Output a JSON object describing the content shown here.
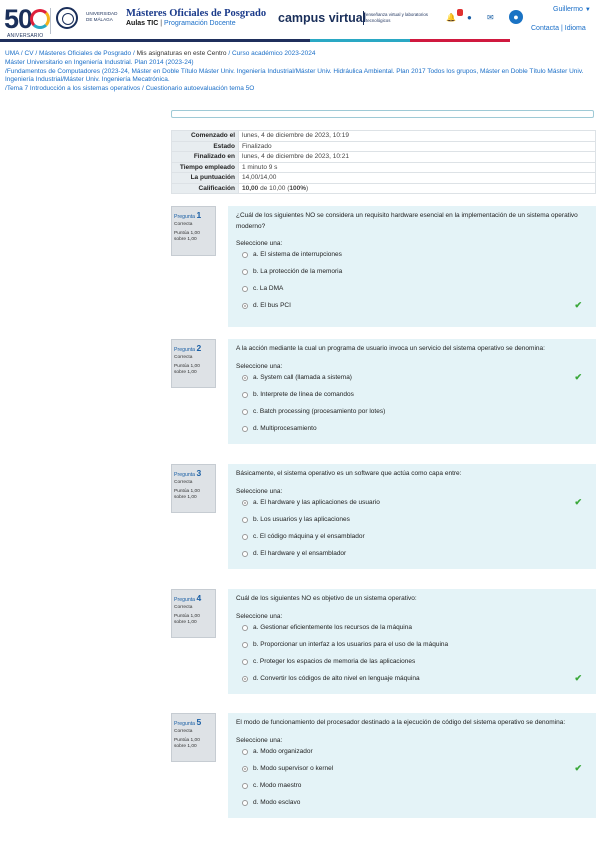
{
  "header": {
    "logo_number": "50",
    "logo_caption": "ANIVERSARIO",
    "university_name": "UNIVERSIDAD DE MÁLAGA",
    "masters_title": "Másteres Oficiales de Posgrado",
    "aulas_label": "Aulas TIC",
    "divider": "|",
    "programacion_label": "Programación Docente",
    "campus_title": "campus virtual",
    "campus_tagline": "enseñanza virtual y laboratorios tecnológicos",
    "notifications_badge": "",
    "user_name": "Guillermo",
    "contact_label": "Contacta",
    "links_sep": "|",
    "language_label": "Idioma",
    "accent_bar_colors": [
      "#1f2f5c",
      "#2aa8c4",
      "#d0193f"
    ]
  },
  "breadcrumb": [
    {
      "label": "UMA",
      "sep": "/ "
    },
    {
      "label": "CV",
      "sep": "/ "
    },
    {
      "label": "Másteres Oficiales de Posgrado",
      "sep": "/ "
    },
    {
      "label": "Mis asignaturas en este Centro",
      "sep": "/ ",
      "current": true
    },
    {
      "label": "Curso académico 2023-2024",
      "sep": ""
    },
    {
      "label": "Máster Universitario en Ingeniería Industrial. Plan 2014 (2023-24)",
      "sep": "/"
    },
    {
      "label": "Fundamentos de Computadores (2023-24, Máster en Doble Título Máster Univ. Ingeniería Industrial/Máster Univ. Hidráulica Ambiental. Plan 2017 Todos los grupos, Máster en Doble Título Máster Univ. Ingeniería Industrial/Máster Univ. Ingeniería Mecatrónica.",
      "sep": "/"
    },
    {
      "label": "Tema 7 Introducción a los sistemas operativos",
      "sep": "/ "
    },
    {
      "label": "Cuestionario autoevaluación tema 5O",
      "sep": ""
    }
  ],
  "summary": [
    {
      "key": "Comenzado el",
      "value": "lunes, 4 de diciembre de 2023, 10:19"
    },
    {
      "key": "Estado",
      "value": "Finalizado"
    },
    {
      "key": "Finalizado en",
      "value": "lunes, 4 de diciembre de 2023, 10:21"
    },
    {
      "key": "Tiempo empleado",
      "value": "1 minuto 9 s"
    },
    {
      "key": "La puntuación",
      "value": "14,00/14,00"
    },
    {
      "key": "Calificación",
      "value_bold": "10,00",
      "value_mid": " de 10,00 (",
      "value_pct": "100%",
      "value_end": ")"
    }
  ],
  "questions": [
    {
      "label": "Pregunta",
      "number": "1",
      "status": "Correcta",
      "points_line1": "Puntúa 1,00",
      "points_line2": "sobre 1,00",
      "text": "¿Cuál de los siguientes NO se considera un requisito hardware esencial en la implementación de un sistema operativo moderno?",
      "select_label": "Seleccione una:",
      "options": [
        {
          "label": "a. El sistema de interrupciones",
          "selected": false
        },
        {
          "label": "b. La protección de la memoria",
          "selected": false
        },
        {
          "label": "c. La DMA",
          "selected": false
        },
        {
          "label": "d. El bus PCI",
          "selected": true,
          "check": "✔"
        }
      ]
    },
    {
      "label": "Pregunta",
      "number": "2",
      "status": "Correcta",
      "points_line1": "Puntúa 1,00",
      "points_line2": "sobre 1,00",
      "text": "A la acción mediante la cual un programa de usuario invoca un servicio del sistema operativo se denomina:",
      "select_label": "Seleccione una:",
      "options": [
        {
          "label": "a. System call (llamada a sistema)",
          "selected": true,
          "check": "✔"
        },
        {
          "label": "b. Interprete de línea de comandos",
          "selected": false
        },
        {
          "label": "c. Batch processing (procesamiento por lotes)",
          "selected": false
        },
        {
          "label": "d. Multiprocesamiento",
          "selected": false
        }
      ]
    },
    {
      "label": "Pregunta",
      "number": "3",
      "status": "Correcta",
      "points_line1": "Puntúa 1,00",
      "points_line2": "sobre 1,00",
      "text": "Básicamente, el sistema operativo es un software que actúa como capa entre:",
      "select_label": "Seleccione una:",
      "options": [
        {
          "label": "a. El hardware y las aplicaciones de usuario",
          "selected": true,
          "check": "✔"
        },
        {
          "label": "b. Los usuarios y las aplicaciones",
          "selected": false
        },
        {
          "label": "c. El código máquina y el ensamblador",
          "selected": false
        },
        {
          "label": "d. El hardware y el ensamblador",
          "selected": false
        }
      ]
    },
    {
      "label": "Pregunta",
      "number": "4",
      "status": "Correcta",
      "points_line1": "Puntúa 1,00",
      "points_line2": "sobre 1,00",
      "text": "Cuál de los siguientes NO es objetivo de un sistema operativo:",
      "select_label": "Seleccione una:",
      "options": [
        {
          "label": "a. Gestionar eficientemente los recursos de la máquina",
          "selected": false
        },
        {
          "label": "b. Proporcionar un interfaz a los usuarios para el uso de la máquina",
          "selected": false
        },
        {
          "label": "c. Proteger los espacios de memoria de las aplicaciones",
          "selected": false
        },
        {
          "label": "d. Convertir los códigos de alto nivel en lenguaje máquina",
          "selected": true,
          "check": "✔"
        }
      ]
    },
    {
      "label": "Pregunta",
      "number": "5",
      "status": "Correcta",
      "points_line1": "Puntúa 1,00",
      "points_line2": "sobre 1,00",
      "text": "El modo de funcionamiento del procesador destinado a la ejecución de código del sistema operativo se denomina:",
      "select_label": "Seleccione una:",
      "options": [
        {
          "label": "a. Modo organizador",
          "selected": false
        },
        {
          "label": "b. Modo supervisor o kernel",
          "selected": true,
          "check": "✔"
        },
        {
          "label": "c. Modo maestro",
          "selected": false
        },
        {
          "label": "d. Modo esclavo",
          "selected": false
        }
      ]
    }
  ]
}
